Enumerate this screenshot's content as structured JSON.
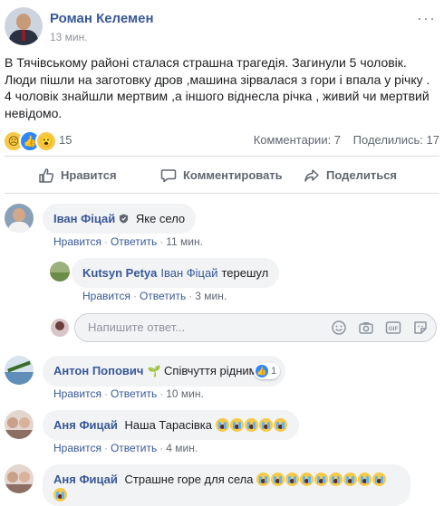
{
  "post": {
    "author": "Роман Келемен",
    "time": "13 мин.",
    "menu_label": "···",
    "text": "В Тячівському районі сталася страшна трагедія. Загинули 5 чоловік. Люди пішли на заготовку дров ,машина зірвалася з гори і впала у річку . 4 чоловік знайшли мертвим ,а іншого віднесла річка , живий чи мертвий невідомо.",
    "reactions": {
      "icons": [
        "sad-reaction",
        "like-reaction",
        "wow-reaction"
      ],
      "count": "15"
    },
    "comments_label": "Комментарии: 7",
    "shares_label": "Поделились: 17"
  },
  "actions": {
    "like": "Нравится",
    "comment": "Комментировать",
    "share": "Поделиться"
  },
  "meta_links": {
    "like": "Нравится",
    "reply": "Ответить"
  },
  "comments": [
    {
      "author": "Іван Фіцай",
      "badge": "verified",
      "text": "Яке село",
      "time": "11 мин."
    },
    {
      "author": "Kutsyn Petya",
      "mention": "Іван Фіцай",
      "text": "терешул",
      "time": "3 мин."
    },
    {
      "author": "Антон Попович",
      "badge": "plant",
      "text": "Співчуття рідним.",
      "likes": "1",
      "time": "10 мин."
    },
    {
      "author": "Аня Фицай",
      "text": "Наша Тарасівка",
      "emoji_count": 5,
      "time": "4 мин."
    },
    {
      "author": "Аня Фицай",
      "text": "Страшне горе для села",
      "emoji_count": 10
    }
  ],
  "reply_input": {
    "placeholder": "Напишите ответ..."
  },
  "colors": {
    "link": "#385898",
    "meta": "#606770",
    "bubble": "#f2f3f5",
    "like_blue": "#2d88ff"
  }
}
